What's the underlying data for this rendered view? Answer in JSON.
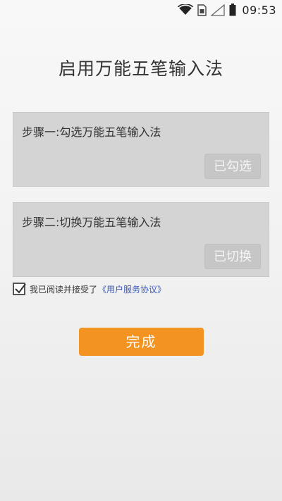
{
  "status_bar": {
    "time": "09:53",
    "icons": [
      "wifi-icon",
      "sim-card-icon",
      "signal-icon",
      "battery-icon"
    ]
  },
  "page": {
    "title": "启用万能五笔输入法"
  },
  "steps": [
    {
      "label": "步骤一:勾选万能五笔输入法",
      "button_label": "已勾选"
    },
    {
      "label": "步骤二:切换万能五笔输入法",
      "button_label": "已切换"
    }
  ],
  "agreement": {
    "checked": true,
    "text": "我已阅读并接受了",
    "link": "《用户服务协议》"
  },
  "done_button": {
    "label": "完成"
  },
  "colors": {
    "accent": "#f39321",
    "link": "#3a57b8",
    "card_bg": "#d4d4d4"
  }
}
